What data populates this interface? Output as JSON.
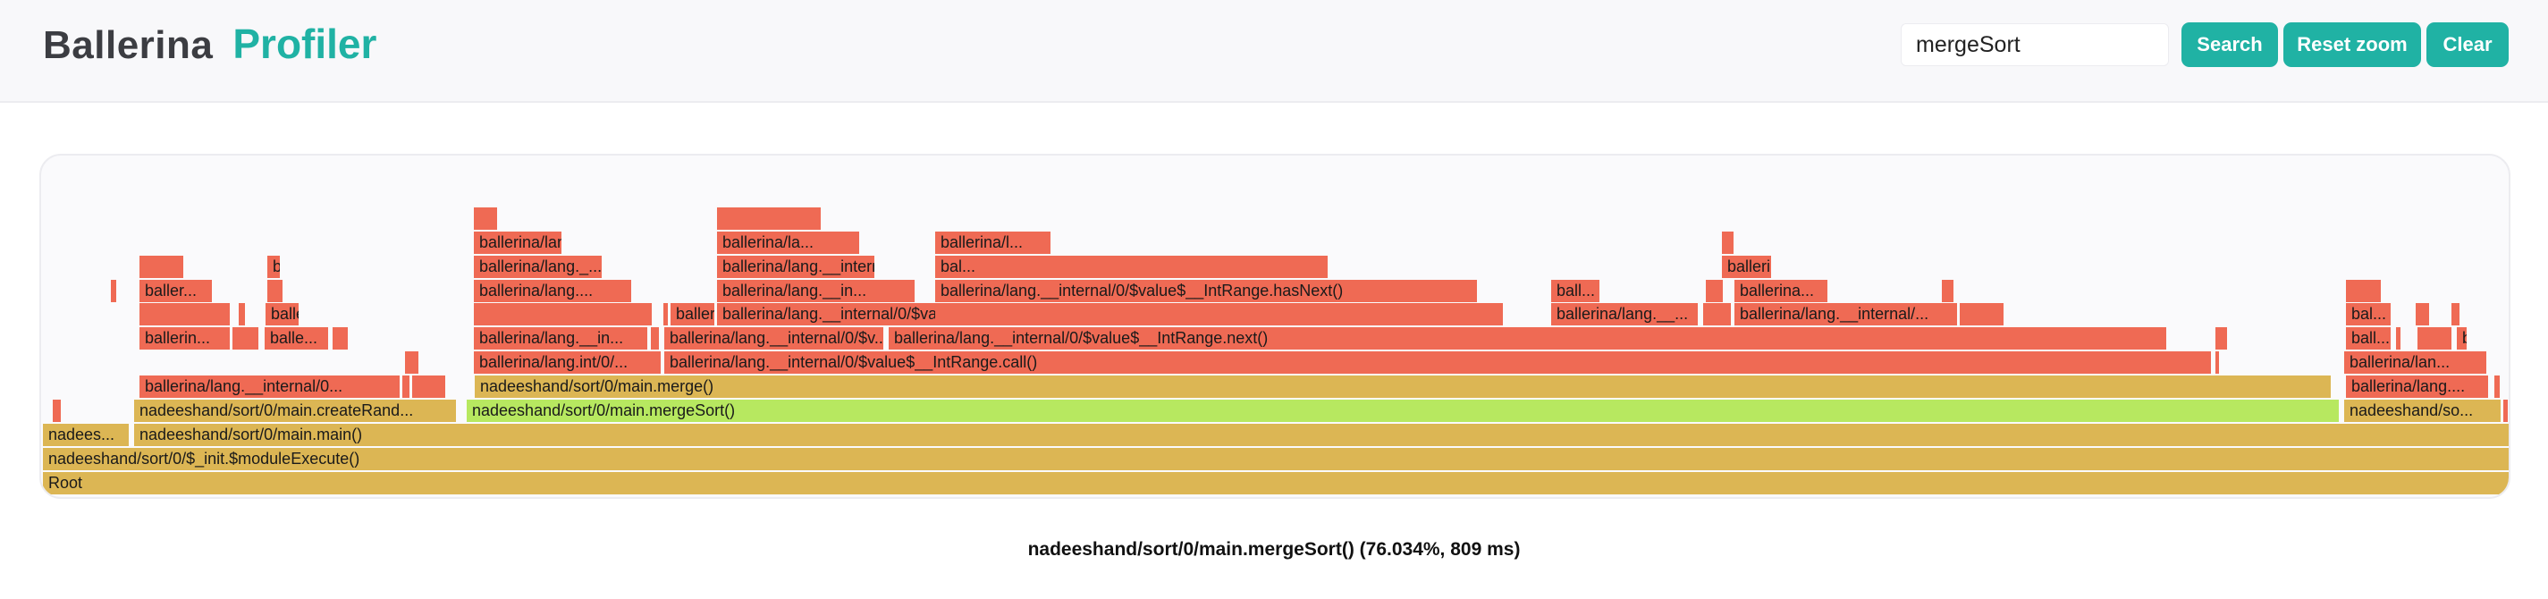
{
  "header": {
    "brand": "Ballerina",
    "product": "Profiler"
  },
  "search": {
    "value": "mergeSort",
    "search_label": "Search",
    "reset_zoom_label": "Reset zoom",
    "clear_label": "Clear"
  },
  "colors": {
    "accent": "#20b2a4",
    "frame_hot": "#ef6a54",
    "frame_default": "#dcb654",
    "frame_highlight": "#b7e860"
  },
  "flamegraph": {
    "frames": [
      {
        "label": "Root",
        "color": "gold"
      },
      {
        "label": "nadeeshand/sort/0/$_init.$moduleExecute()",
        "color": "gold"
      },
      {
        "label": "nadees...",
        "color": "gold"
      },
      {
        "label": "nadeeshand/sort/0/main.main()",
        "color": "gold"
      },
      {
        "label": "",
        "color": "red"
      },
      {
        "label": "nadeeshand/sort/0/main.createRand...",
        "color": "gold"
      },
      {
        "label": "nadeeshand/sort/0/main.mergeSort()",
        "color": "green"
      },
      {
        "label": "nadeeshand/so...",
        "color": "gold"
      },
      {
        "label": "",
        "color": "red"
      },
      {
        "label": "ballerina/lang.__internal/0...",
        "color": "red"
      },
      {
        "label": "",
        "color": "red"
      },
      {
        "label": "",
        "color": "red"
      },
      {
        "label": "nadeeshand/sort/0/main.merge()",
        "color": "gold"
      },
      {
        "label": "ballerina/lang....",
        "color": "red"
      },
      {
        "label": "ballerina/lang.__internal/0...",
        "color": "red"
      },
      {
        "label": "",
        "color": "red"
      },
      {
        "label": "ballerina/lang.int/0/...",
        "color": "red"
      },
      {
        "label": "ballerina/lang.__internal/0/$value$__IntRange.call()",
        "color": "red"
      },
      {
        "label": "",
        "color": "red"
      },
      {
        "label": "ballerina/lan...",
        "color": "red"
      },
      {
        "label": "ballerin...",
        "color": "red"
      },
      {
        "label": "",
        "color": "red"
      },
      {
        "label": "balle...",
        "color": "red"
      },
      {
        "label": "",
        "color": "red"
      },
      {
        "label": "ballerina/lang.__in...",
        "color": "red"
      },
      {
        "label": "",
        "color": "red"
      },
      {
        "label": "ballerina/lang.__internal/0/$v...",
        "color": "red"
      },
      {
        "label": "ballerina/lang.__internal/0/$value$__IntRange.next()",
        "color": "red"
      },
      {
        "label": "",
        "color": "red"
      },
      {
        "label": "ball...",
        "color": "red"
      },
      {
        "label": "",
        "color": "red"
      },
      {
        "label": "",
        "color": "red"
      },
      {
        "label": "ballerin...",
        "color": "red"
      },
      {
        "label": "",
        "color": "red"
      },
      {
        "label": "",
        "color": "red"
      },
      {
        "label": "ballerina/lang.__i...",
        "color": "red"
      },
      {
        "label": "",
        "color": "red"
      },
      {
        "label": "",
        "color": "red"
      },
      {
        "label": "ballerina/lang.__inte...",
        "color": "red"
      },
      {
        "label": "ballerina/lang.__internal/0/$value$__IntRange.call()",
        "color": "red"
      },
      {
        "label": "",
        "color": "red"
      },
      {
        "label": "ballerina/lang.__...",
        "color": "red"
      },
      {
        "label": "",
        "color": "red"
      },
      {
        "label": "ballerina/lang.__internal/...",
        "color": "red"
      },
      {
        "label": "",
        "color": "red"
      },
      {
        "label": "bal...",
        "color": "red"
      },
      {
        "label": "",
        "color": "red"
      },
      {
        "label": "",
        "color": "red"
      },
      {
        "label": "",
        "color": "red"
      },
      {
        "label": "baller...",
        "color": "red"
      },
      {
        "label": "",
        "color": "red"
      },
      {
        "label": "ballerina/lang....",
        "color": "red"
      },
      {
        "label": "ballerina/lang.__in...",
        "color": "red"
      },
      {
        "label": "ballerina/lang.__internal/0/$value$__IntRange.hasNext()",
        "color": "red"
      },
      {
        "label": "ball...",
        "color": "red"
      },
      {
        "label": "",
        "color": "red"
      },
      {
        "label": "ballerina...",
        "color": "red"
      },
      {
        "label": "",
        "color": "red"
      },
      {
        "label": "",
        "color": "red"
      },
      {
        "label": "",
        "color": "red"
      },
      {
        "label": "ballerina/la...",
        "color": "red"
      },
      {
        "label": "ballerina/lang._...",
        "color": "red"
      },
      {
        "label": "ballerina/lang.__internal/0/$value$__IntRang...",
        "color": "red"
      },
      {
        "label": "bal...",
        "color": "red"
      },
      {
        "label": "ballerin...",
        "color": "red"
      },
      {
        "label": "ballerina/lang....",
        "color": "red"
      },
      {
        "label": "ballerina/la...",
        "color": "red"
      },
      {
        "label": "ballerina/l...",
        "color": "red"
      },
      {
        "label": "",
        "color": "red"
      },
      {
        "label": "",
        "color": "red"
      },
      {
        "label": "",
        "color": "red"
      }
    ]
  },
  "status": {
    "selected_frame": "nadeeshand/sort/0/main.mergeSort()",
    "percent": "76.034%",
    "duration": "809 ms",
    "text": "nadeeshand/sort/0/main.mergeSort() (76.034%, 809 ms)"
  }
}
